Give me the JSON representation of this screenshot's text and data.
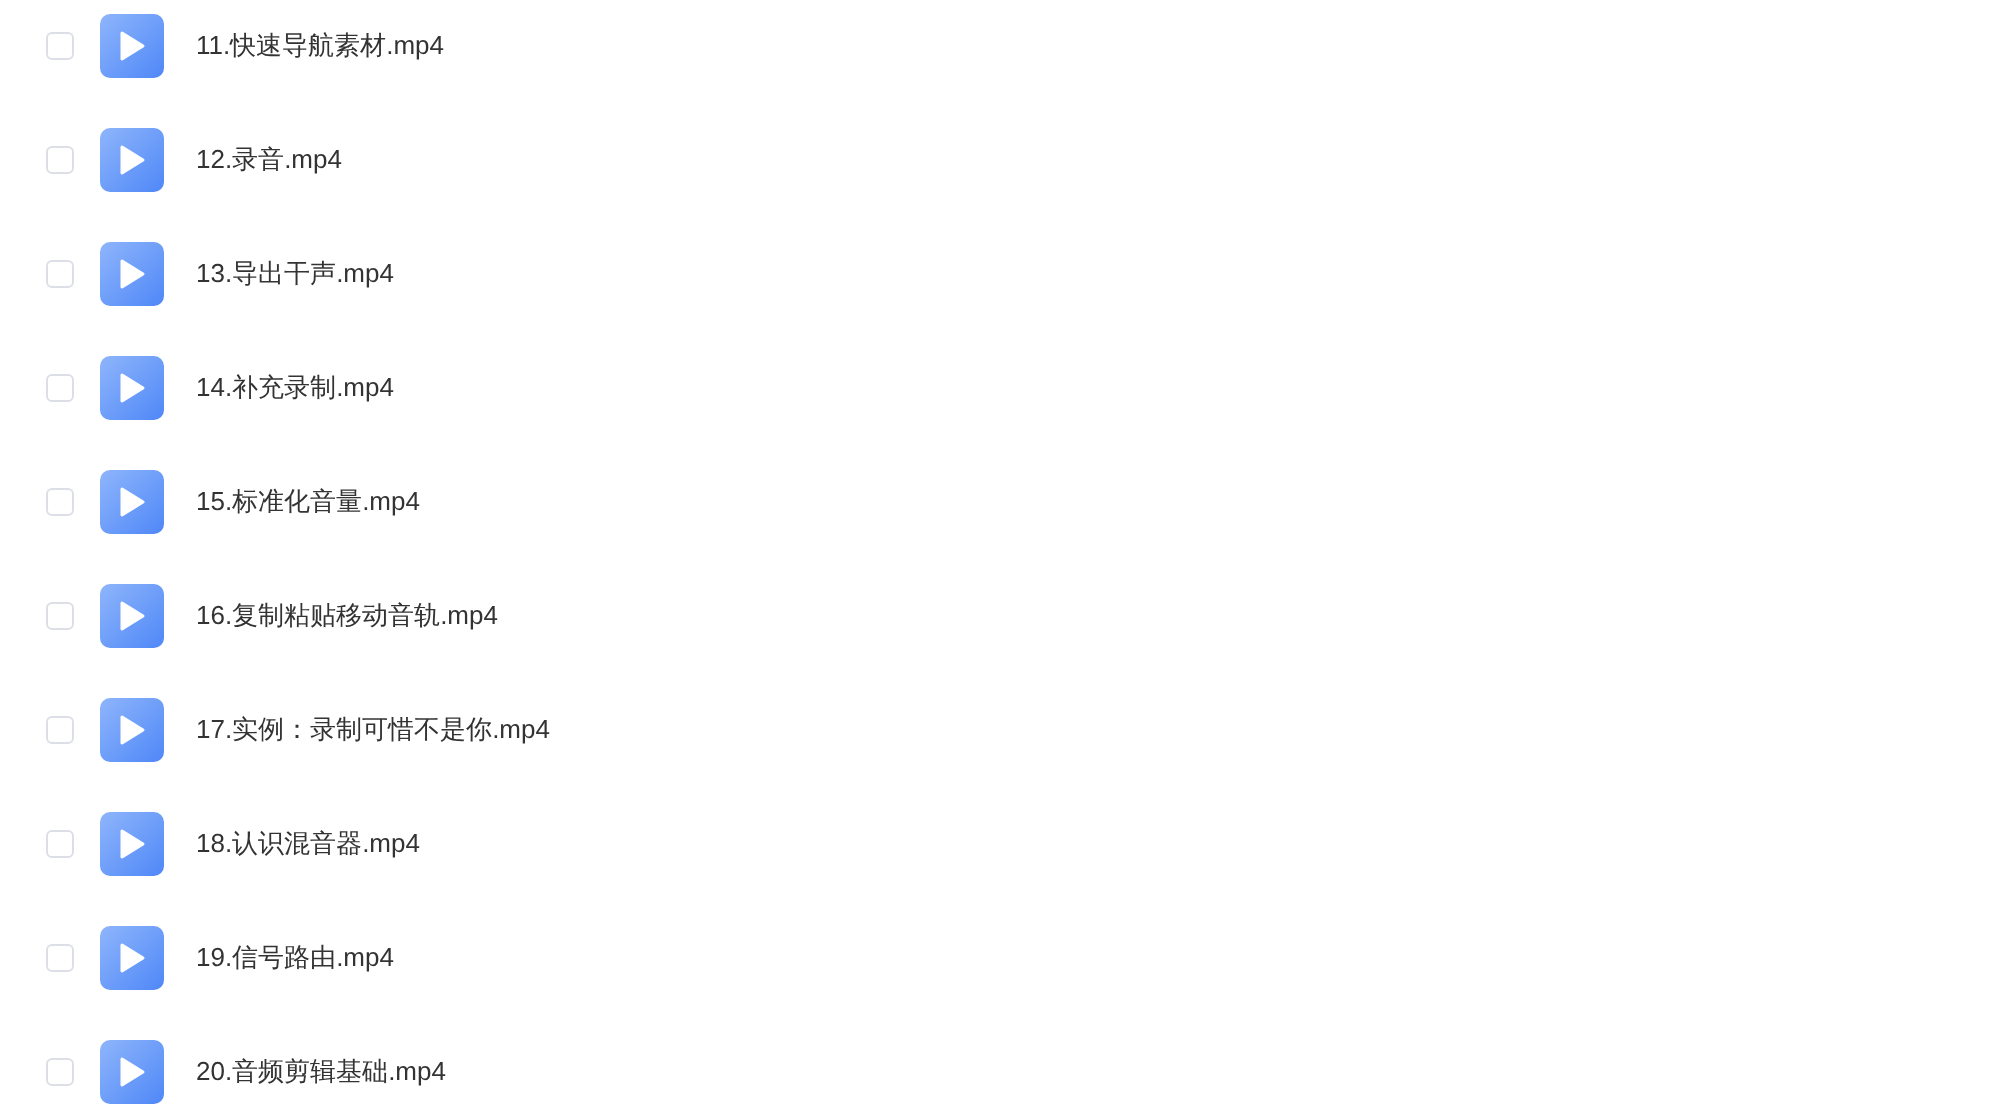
{
  "files": [
    {
      "name": "11.快速导航素材.mp4",
      "checked": false
    },
    {
      "name": "12.录音.mp4",
      "checked": false
    },
    {
      "name": "13.导出干声.mp4",
      "checked": false
    },
    {
      "name": "14.补充录制.mp4",
      "checked": false
    },
    {
      "name": "15.标准化音量.mp4",
      "checked": false
    },
    {
      "name": "16.复制粘贴移动音轨.mp4",
      "checked": false
    },
    {
      "name": "17.实例：录制可惜不是你.mp4",
      "checked": false
    },
    {
      "name": "18.认识混音器.mp4",
      "checked": false
    },
    {
      "name": "19.信号路由.mp4",
      "checked": false
    },
    {
      "name": "20.音频剪辑基础.mp4",
      "checked": false
    }
  ]
}
